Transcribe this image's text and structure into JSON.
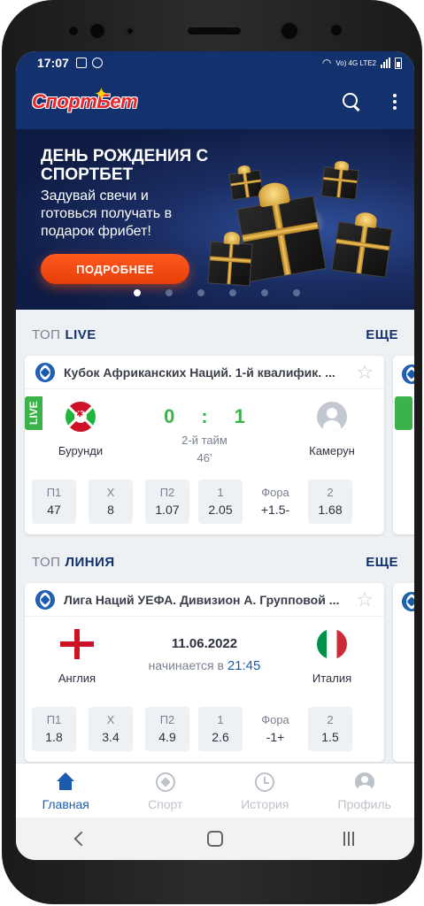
{
  "status_bar": {
    "time": "17:07",
    "network_label": "Vo) 4G LTE2"
  },
  "app": {
    "logo_text": "СпортБет"
  },
  "banner": {
    "title": "ДЕНЬ РОЖДЕНИЯ С СПОРТБЕТ",
    "text": "Задувай свечи и готовься получать в подарок фрибет!",
    "button_label": "ПОДРОБНЕЕ",
    "slide_count": 6,
    "active_slide": 1
  },
  "live_section": {
    "prefix": "ТОП",
    "kind": "LIVE",
    "more_label": "ЕЩЕ",
    "event": {
      "league": "Кубок Африканских Наций. 1-й квалифик. ...",
      "live_badge": "LIVE",
      "home_team": "Бурунди",
      "away_team": "Камерун",
      "home_score": "0",
      "separator": ":",
      "away_score": "1",
      "period": "2-й тайм",
      "minute": "46'",
      "odds": [
        {
          "label": "П1",
          "value": "47"
        },
        {
          "label": "Х",
          "value": "8"
        },
        {
          "label": "П2",
          "value": "1.07"
        },
        {
          "label": "1",
          "value": "2.05"
        },
        {
          "label": "Фора",
          "value": "+1.5-"
        },
        {
          "label": "2",
          "value": "1.68"
        }
      ]
    }
  },
  "line_section": {
    "prefix": "ТОП",
    "kind": "ЛИНИЯ",
    "more_label": "ЕЩЕ",
    "event": {
      "league": "Лига Наций УЕФА. Дивизион А. Групповой ...",
      "home_team": "Англия",
      "away_team": "Италия",
      "date": "11.06.2022",
      "starts_label": "начинается в",
      "start_time": "21:45",
      "odds": [
        {
          "label": "П1",
          "value": "1.8"
        },
        {
          "label": "Х",
          "value": "3.4"
        },
        {
          "label": "П2",
          "value": "4.9"
        },
        {
          "label": "1",
          "value": "2.6"
        },
        {
          "label": "Фора",
          "value": "-1+"
        },
        {
          "label": "2",
          "value": "1.5"
        }
      ]
    }
  },
  "bottom_nav": {
    "items": [
      {
        "label": "Главная",
        "icon": "home-icon",
        "active": true
      },
      {
        "label": "Спорт",
        "icon": "sport-icon",
        "active": false
      },
      {
        "label": "История",
        "icon": "history-icon",
        "active": false
      },
      {
        "label": "Профиль",
        "icon": "profile-icon",
        "active": false
      }
    ]
  },
  "colors": {
    "brand_navy": "#13316c",
    "accent_blue": "#1a5bb0",
    "live_green": "#3cb34a",
    "cta_orange": "#ff5a1e",
    "logo_red": "#e8262b"
  }
}
